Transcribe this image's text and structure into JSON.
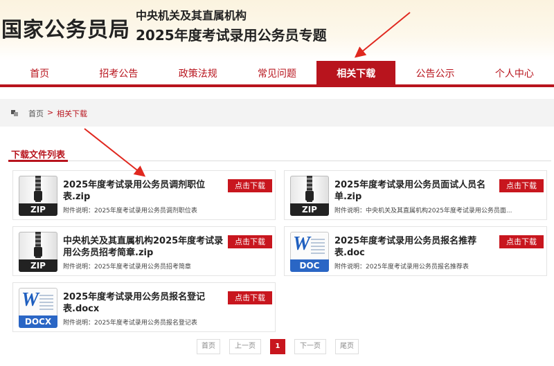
{
  "header": {
    "site_title": "国家公务员局",
    "subtitle_1": "中央机关及其直属机构",
    "subtitle_2": "2025年度考试录用公务员专题"
  },
  "nav": {
    "items": [
      "首页",
      "招考公告",
      "政策法规",
      "常见问题",
      "相关下载",
      "公告公示",
      "个人中心"
    ],
    "active": "相关下载"
  },
  "breadcrumb": {
    "home": "首页",
    "separator": ">",
    "current": "相关下载"
  },
  "section": {
    "title": "下载文件列表"
  },
  "files": [
    {
      "title": "2025年度考试录用公务员调剂职位表.zip",
      "desc": "附件说明：2025年度考试录用公务员调剂职位表",
      "icon": "zip-file-icon",
      "icon_label": "ZIP",
      "button": "点击下载"
    },
    {
      "title": "2025年度考试录用公务员面试人员名单.zip",
      "desc": "附件说明：中央机关及其直属机构2025年度考试录用公务员面...",
      "icon": "zip-file-icon",
      "icon_label": "ZIP",
      "button": "点击下载"
    },
    {
      "title": "中央机关及其直属机构2025年度考试录用公务员招考简章.zip",
      "desc": "附件说明：2025年度考试录用公务员招考简章",
      "icon": "zip-file-icon",
      "icon_label": "ZIP",
      "button": "点击下载"
    },
    {
      "title": "2025年度考试录用公务员报名推荐表.doc",
      "desc": "附件说明：2025年度考试录用公务员报名推荐表",
      "icon": "word-file-icon",
      "icon_label": "DOC",
      "button": "点击下载"
    },
    {
      "title": "2025年度考试录用公务员报名登记表.docx",
      "desc": "附件说明：2025年度考试录用公务员报名登记表",
      "icon": "word-file-icon",
      "icon_label": "DOCX",
      "button": "点击下载"
    }
  ],
  "pagination": {
    "first": "首页",
    "prev": "上一页",
    "current": "1",
    "next": "下一页",
    "last": "尾页"
  },
  "colors": {
    "accent": "#b8141d",
    "button": "#c8161e",
    "annotation_arrow": "#e0281f"
  }
}
